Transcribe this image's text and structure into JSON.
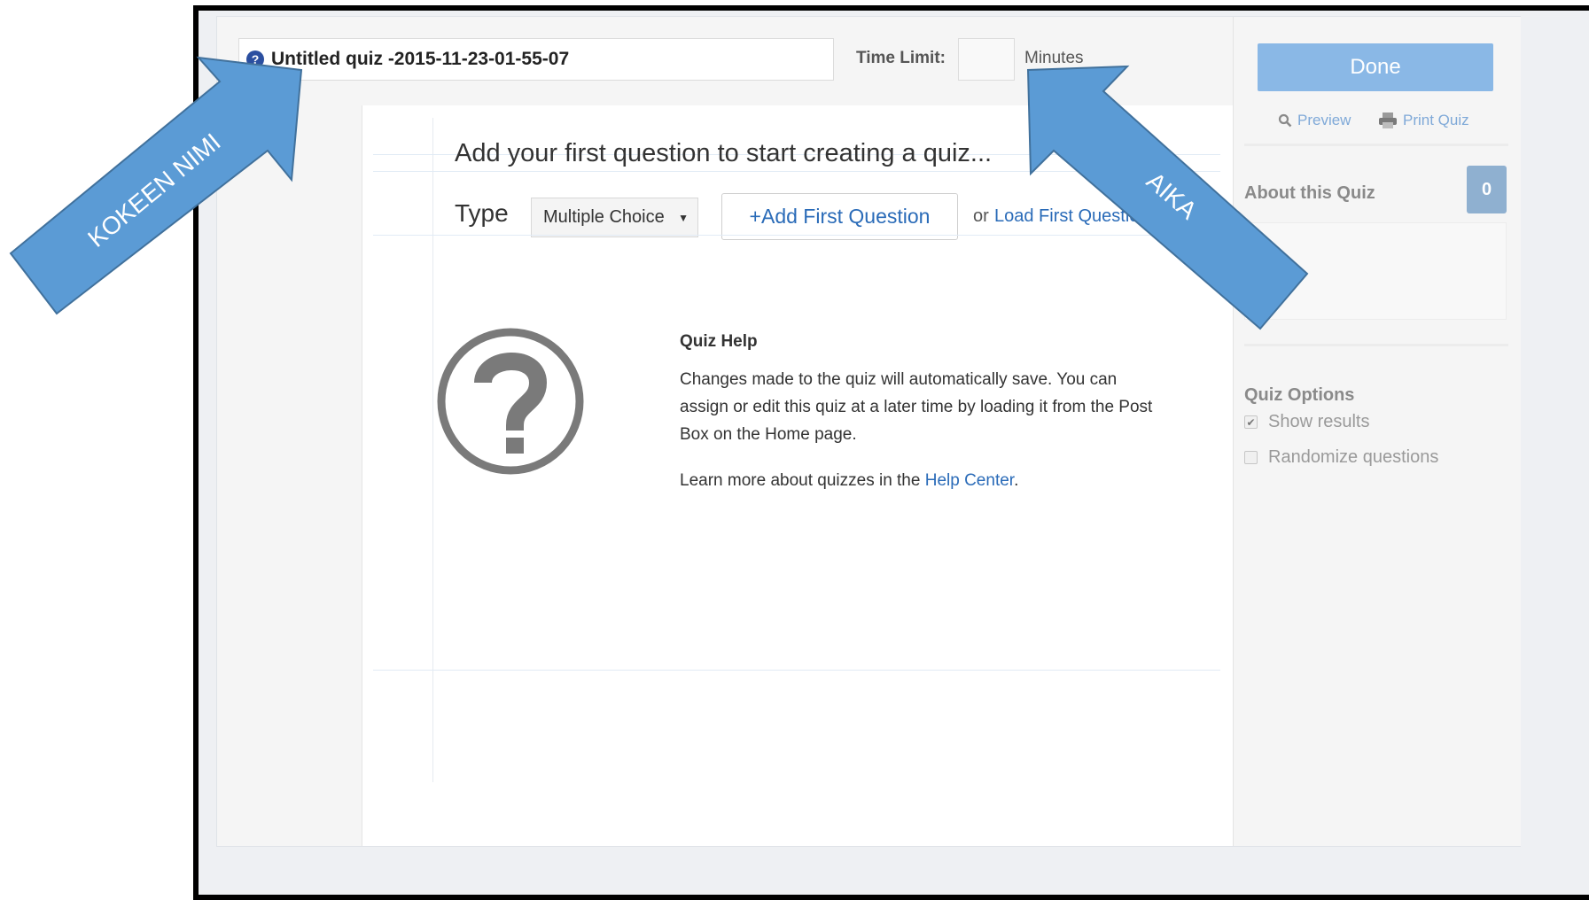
{
  "header": {
    "help_icon": "?",
    "quiz_title": "Untitled quiz -2015-11-23-01-55-07",
    "time_limit_label": "Time Limit:",
    "time_limit_value": "",
    "minutes_label": "Minutes"
  },
  "editor": {
    "prompt": "Add your first question to start creating a quiz...",
    "type_label": "Type",
    "type_selected": "Multiple Choice",
    "add_button": "+Add First Question",
    "or_text": "or",
    "load_link": "Load First Question"
  },
  "help": {
    "title": "Quiz Help",
    "paragraph": "Changes made to the quiz will automatically save. You can assign or edit this quiz at a later time by loading it from the Post Box on the Home page.",
    "learn_more_prefix": "Learn more about quizzes in the ",
    "help_center_link": "Help Center",
    "learn_more_suffix": "."
  },
  "sidebar": {
    "done_button": "Done",
    "preview_link": "Preview",
    "print_link": "Print Quiz",
    "about_label": "About this Quiz",
    "about_count": "0",
    "options_label": "Quiz Options",
    "options": [
      {
        "label": "Show results",
        "checked": true
      },
      {
        "label": "Randomize questions",
        "checked": false
      }
    ]
  },
  "annotations": {
    "left_arrow_text": "KOKEEN NIMI",
    "right_arrow_text": "AIKA",
    "arrow_color": "#5b9bd5"
  }
}
